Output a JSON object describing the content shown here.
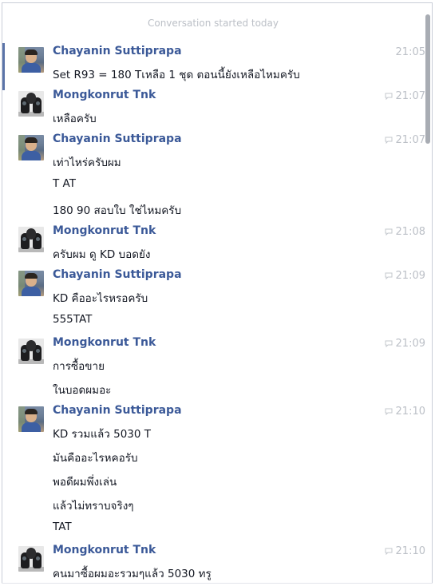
{
  "header": {
    "started": "Conversation started today"
  },
  "messages": [
    {
      "sender": "Chayanin Suttiprapa",
      "avatar": "chayanin",
      "time": "21:05",
      "reply_icon": false,
      "lines": [
        "Set R93 = 180 Tเหลือ 1 ชุด  ตอนนี้ยังเหลือไหมครับ"
      ]
    },
    {
      "sender": "Mongkonrut Tnk",
      "avatar": "mongkonrut",
      "time": "21:07",
      "reply_icon": true,
      "lines": [
        "เหลือครับ"
      ]
    },
    {
      "sender": "Chayanin Suttiprapa",
      "avatar": "chayanin",
      "time": "21:07",
      "reply_icon": true,
      "lines": [
        "เท่าไหร่ครับผม",
        "T AT",
        "180 90 สอบใบ ใช่ไหมครับ"
      ]
    },
    {
      "sender": "Mongkonrut Tnk",
      "avatar": "mongkonrut",
      "time": "21:08",
      "reply_icon": true,
      "lines": [
        "ครับผม ดู KD บอดยัง"
      ]
    },
    {
      "sender": "Chayanin Suttiprapa",
      "avatar": "chayanin",
      "time": "21:09",
      "reply_icon": true,
      "lines": [
        "KD คืออะไรหรอครับ",
        "555TAT"
      ]
    },
    {
      "sender": "Mongkonrut Tnk",
      "avatar": "mongkonrut",
      "time": "21:09",
      "reply_icon": true,
      "lines": [
        "การซื้อขาย",
        "ในบอดผมอะ"
      ]
    },
    {
      "sender": "Chayanin Suttiprapa",
      "avatar": "chayanin",
      "time": "21:10",
      "reply_icon": true,
      "lines": [
        "KD รวมแล้ว 5030 T",
        "มันคืออะไรหคอรับ",
        "พอดีผมพึ่งเล่น",
        "แล้วไม่ทราบจริงๆ",
        "TAT"
      ]
    },
    {
      "sender": "Mongkonrut Tnk",
      "avatar": "mongkonrut",
      "time": "21:10",
      "reply_icon": true,
      "lines": [
        "คนมาซื้อผมอะรวมๆแล้ว 5030 ทรู"
      ]
    }
  ],
  "colors": {
    "name": "#3b5998",
    "meta": "#bcc0c7",
    "text": "#141823",
    "unread_bar": "#5b74a8"
  },
  "icons": {
    "reply": "reply-bubble-icon"
  }
}
